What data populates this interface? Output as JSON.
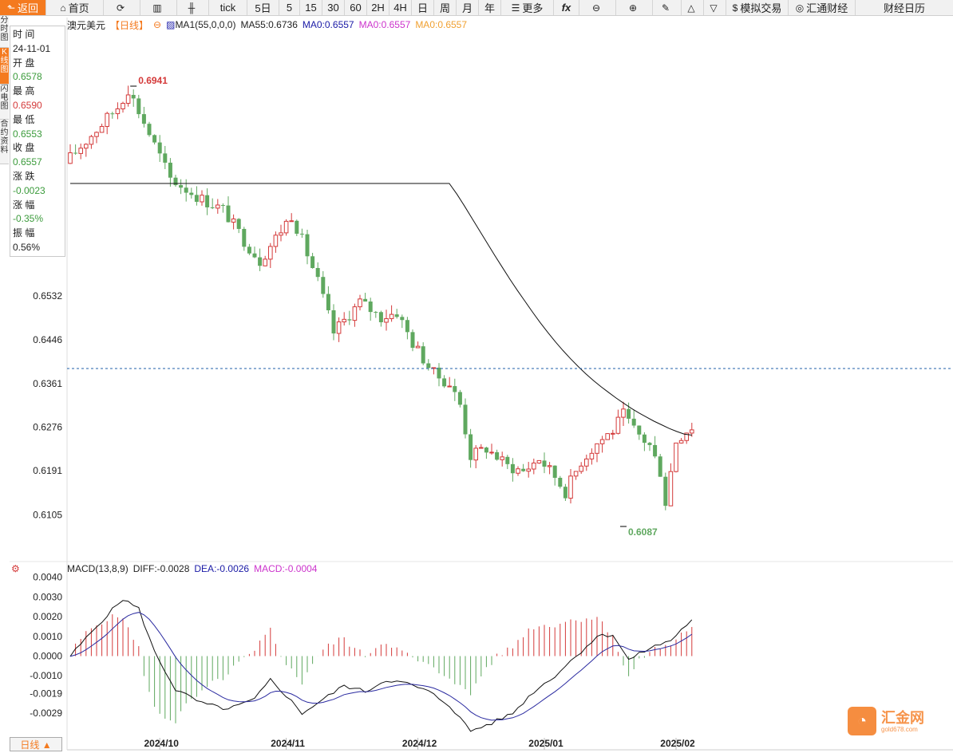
{
  "toolbar": [
    {
      "name": "back-button",
      "icon": "⬑",
      "label": "返回",
      "w": 58
    },
    {
      "name": "home-button",
      "icon": "⌂",
      "label": "首页",
      "w": 72
    },
    {
      "name": "refresh-button",
      "icon": "⟳",
      "label": "",
      "w": 46
    },
    {
      "name": "bar-chart-button",
      "icon": "▥",
      "label": "",
      "w": 46
    },
    {
      "name": "candle-chart-button",
      "icon": "╫",
      "label": "",
      "w": 40
    },
    {
      "name": "tick-button",
      "icon": "",
      "label": "tick",
      "w": 48
    },
    {
      "name": "period-5day-button",
      "icon": "",
      "label": "5日",
      "w": 40
    },
    {
      "name": "period-5min-button",
      "icon": "",
      "label": "5",
      "w": 26
    },
    {
      "name": "period-15min-button",
      "icon": "",
      "label": "15",
      "w": 28
    },
    {
      "name": "period-30min-button",
      "icon": "",
      "label": "30",
      "w": 28
    },
    {
      "name": "period-60min-button",
      "icon": "",
      "label": "60",
      "w": 28
    },
    {
      "name": "period-2h-button",
      "icon": "",
      "label": "2H",
      "w": 28
    },
    {
      "name": "period-4h-button",
      "icon": "",
      "label": "4H",
      "w": 28
    },
    {
      "name": "period-day-button",
      "icon": "",
      "label": "日",
      "w": 28
    },
    {
      "name": "period-week-button",
      "icon": "",
      "label": "周",
      "w": 28
    },
    {
      "name": "period-month-button",
      "icon": "",
      "label": "月",
      "w": 28
    },
    {
      "name": "period-year-button",
      "icon": "",
      "label": "年",
      "w": 28
    },
    {
      "name": "more-button",
      "icon": "☰",
      "label": "更多",
      "w": 66
    },
    {
      "name": "formula-button",
      "icon": "",
      "label": "fx",
      "w": 32
    },
    {
      "name": "zoom-out-button",
      "icon": "⊖",
      "label": "",
      "w": 46
    },
    {
      "name": "zoom-in-button",
      "icon": "⊕",
      "label": "",
      "w": 46
    },
    {
      "name": "draw-pen-button",
      "icon": "✎",
      "label": "",
      "w": 36
    },
    {
      "name": "triangle-up-button",
      "icon": "△",
      "label": "",
      "w": 28
    },
    {
      "name": "triangle-down-button",
      "icon": "▽",
      "label": "",
      "w": 28
    },
    {
      "name": "simulate-trade-button",
      "icon": "$",
      "label": "模拟交易",
      "w": 78
    },
    {
      "name": "fx678-button",
      "icon": "◎",
      "label": "汇通财经",
      "w": 84
    },
    {
      "name": "calendar-button",
      "icon": "",
      "label": "财经日历",
      "w": 0
    }
  ],
  "vtabs": [
    {
      "name": "tab-timeshare",
      "label": "分时图",
      "active": false,
      "h": 40
    },
    {
      "name": "tab-kline",
      "label": "K线图",
      "active": true,
      "h": 46
    },
    {
      "name": "tab-flash",
      "label": "闪电图",
      "active": false,
      "h": 44
    },
    {
      "name": "tab-contract",
      "label": "合约资料",
      "active": false,
      "h": 56
    }
  ],
  "info": [
    {
      "text": "时 间",
      "cls": ""
    },
    {
      "text": "24-11-01",
      "cls": ""
    },
    {
      "text": "开 盘",
      "cls": ""
    },
    {
      "text": "0.6578",
      "cls": "green"
    },
    {
      "text": "最 高",
      "cls": ""
    },
    {
      "text": "0.6590",
      "cls": "red"
    },
    {
      "text": "最 低",
      "cls": ""
    },
    {
      "text": "0.6553",
      "cls": "green"
    },
    {
      "text": "收 盘",
      "cls": ""
    },
    {
      "text": "0.6557",
      "cls": "green"
    },
    {
      "text": "涨 跌",
      "cls": ""
    },
    {
      "text": "-0.0023",
      "cls": "green"
    },
    {
      "text": "涨 幅",
      "cls": ""
    },
    {
      "text": "-0.35%",
      "cls": "green"
    },
    {
      "text": "振 幅",
      "cls": ""
    },
    {
      "text": "0.56%",
      "cls": ""
    }
  ],
  "legend": {
    "symbol": "澳元美元",
    "period": "【日线】",
    "ma_main": "MA1(55,0,0,0)",
    "ma55": "MA55:0.6736",
    "ma0_a": "MA0:0.6557",
    "ma0_b": "MA0:0.6557",
    "ma0_c": "MA0:0.6557"
  },
  "colors": {
    "up": "#d43a3a",
    "down": "#5fa85f",
    "ma55": "#111111",
    "ma0_a": "#1a1aa6",
    "ma0_b": "#cc33cc",
    "ma0_c": "#f0a030",
    "dea": "#2a2aa0",
    "macd_legend": "#cc33cc"
  },
  "macd_legend": {
    "title": "MACD(13,8,9)",
    "diff": "DIFF:-0.0028",
    "dea": "DEA:-0.0026",
    "macd": "MACD:-0.0004"
  },
  "timeframe_button": "日线 ▲",
  "logo": {
    "glyph": "◔",
    "name": "汇金网",
    "url": "gold678.com"
  },
  "chart_data": {
    "type": "candlestick",
    "price_axis_ticks": [
      "0.6532",
      "0.6446",
      "0.6361",
      "0.6276",
      "0.6191",
      "0.6105"
    ],
    "macd_axis_ticks": [
      "0.0040",
      "0.0030",
      "0.0020",
      "0.0010",
      "0.0000",
      "-0.0010",
      "-0.0019",
      "-0.0029"
    ],
    "x_ticks": [
      "2024/10",
      "2024/11",
      "2024/12",
      "2025/01",
      "2025/02"
    ],
    "x_tick_index": [
      17,
      41,
      66,
      90,
      115
    ],
    "annotations": {
      "high": "0.6941",
      "low": "0.6087"
    },
    "current_price": 0.6399,
    "ma55": [
      0.683,
      0.6834,
      0.6838,
      0.6842,
      0.6846,
      0.685,
      0.6854,
      0.6858,
      0.6862,
      0.6866,
      0.687,
      0.6874,
      0.6878,
      0.6882,
      0.6886,
      0.689,
      0.6894,
      0.6898,
      0.6902,
      0.6906,
      0.691,
      0.6914,
      0.692,
      0.6926,
      0.6932,
      0.6938,
      0.6944,
      0.695,
      0.6956,
      0.696,
      0.6963,
      0.6964,
      0.6964,
      0.6963,
      0.6961,
      0.6958,
      0.6953,
      0.6947,
      0.694,
      0.6931,
      0.6921,
      0.691,
      0.6896,
      0.6882,
      0.6867,
      0.6852,
      0.6836,
      0.6818,
      0.68,
      0.678,
      0.676,
      0.6737,
      0.6714,
      0.669,
      0.6666,
      0.6642,
      0.6618,
      0.6595,
      0.6572,
      0.655,
      0.6529,
      0.6508,
      0.6488,
      0.6469,
      0.6451,
      0.6434,
      0.6418,
      0.6403,
      0.6389,
      0.6376,
      0.6364,
      0.6353,
      0.6342,
      0.6332,
      0.6322,
      0.6313,
      0.6305,
      0.6297,
      0.629,
      0.6283,
      0.6277,
      0.6272,
      0.627
    ]
  }
}
